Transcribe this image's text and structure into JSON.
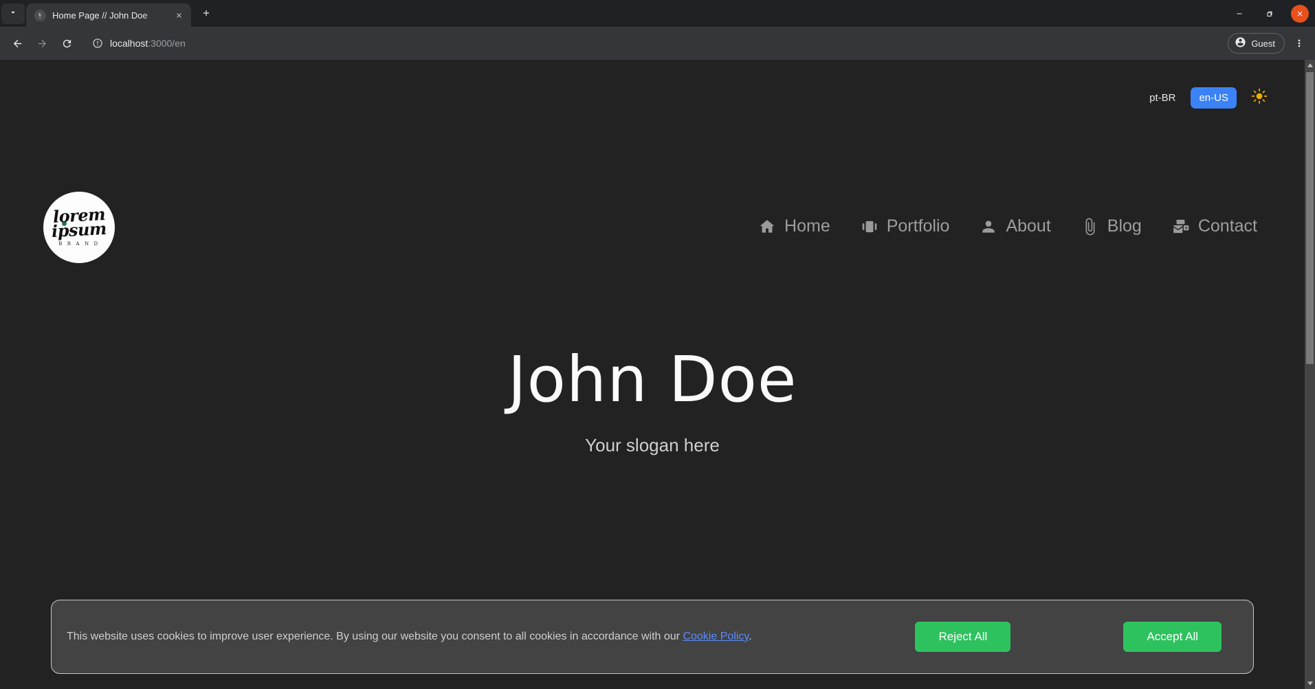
{
  "browser": {
    "tab": {
      "title": "Home Page // John Doe",
      "favicon": "site-favicon",
      "close_icon": "close-icon"
    },
    "tab_search_icon": "chevron-down-icon",
    "new_tab_icon": "plus-icon",
    "window_controls": {
      "minimize": "minimize-icon",
      "maximize": "maximize-icon",
      "close": "close-icon"
    },
    "toolbar": {
      "back_icon": "arrow-left-icon",
      "forward_icon": "arrow-right-icon",
      "reload_icon": "reload-icon",
      "site_info_icon": "info-circle-icon",
      "url_host": "localhost",
      "url_rest": ":3000/en",
      "profile_label": "Guest",
      "profile_icon": "account-circle-icon",
      "menu_icon": "kebab-menu-icon"
    },
    "scrollbar": {
      "up_icon": "caret-up-icon",
      "down_icon": "caret-down-icon"
    }
  },
  "site": {
    "language_switcher": {
      "options": [
        {
          "label": "pt-BR",
          "active": false
        },
        {
          "label": "en-US",
          "active": true
        }
      ],
      "active_color": "#3b82f6"
    },
    "theme_toggle": {
      "icon": "sun-icon",
      "color": "#f0b000"
    },
    "logo": {
      "line1": "lorem",
      "line2": "ipsum",
      "line3": "B R A N D"
    },
    "nav": [
      {
        "label": "Home",
        "icon": "home-icon"
      },
      {
        "label": "Portfolio",
        "icon": "carousel-icon"
      },
      {
        "label": "About",
        "icon": "person-icon"
      },
      {
        "label": "Blog",
        "icon": "paperclip-icon"
      },
      {
        "label": "Contact",
        "icon": "mail-contact-icon"
      }
    ],
    "hero": {
      "title": "John Doe",
      "slogan": "Your slogan here"
    },
    "cookie_banner": {
      "text_before": "This website uses cookies to improve user experience. By using our website you consent to all cookies in accordance with our ",
      "link_label": "Cookie Policy",
      "text_after": ".",
      "reject_label": "Reject All",
      "accept_label": "Accept All",
      "button_color": "#2ec25f"
    }
  }
}
